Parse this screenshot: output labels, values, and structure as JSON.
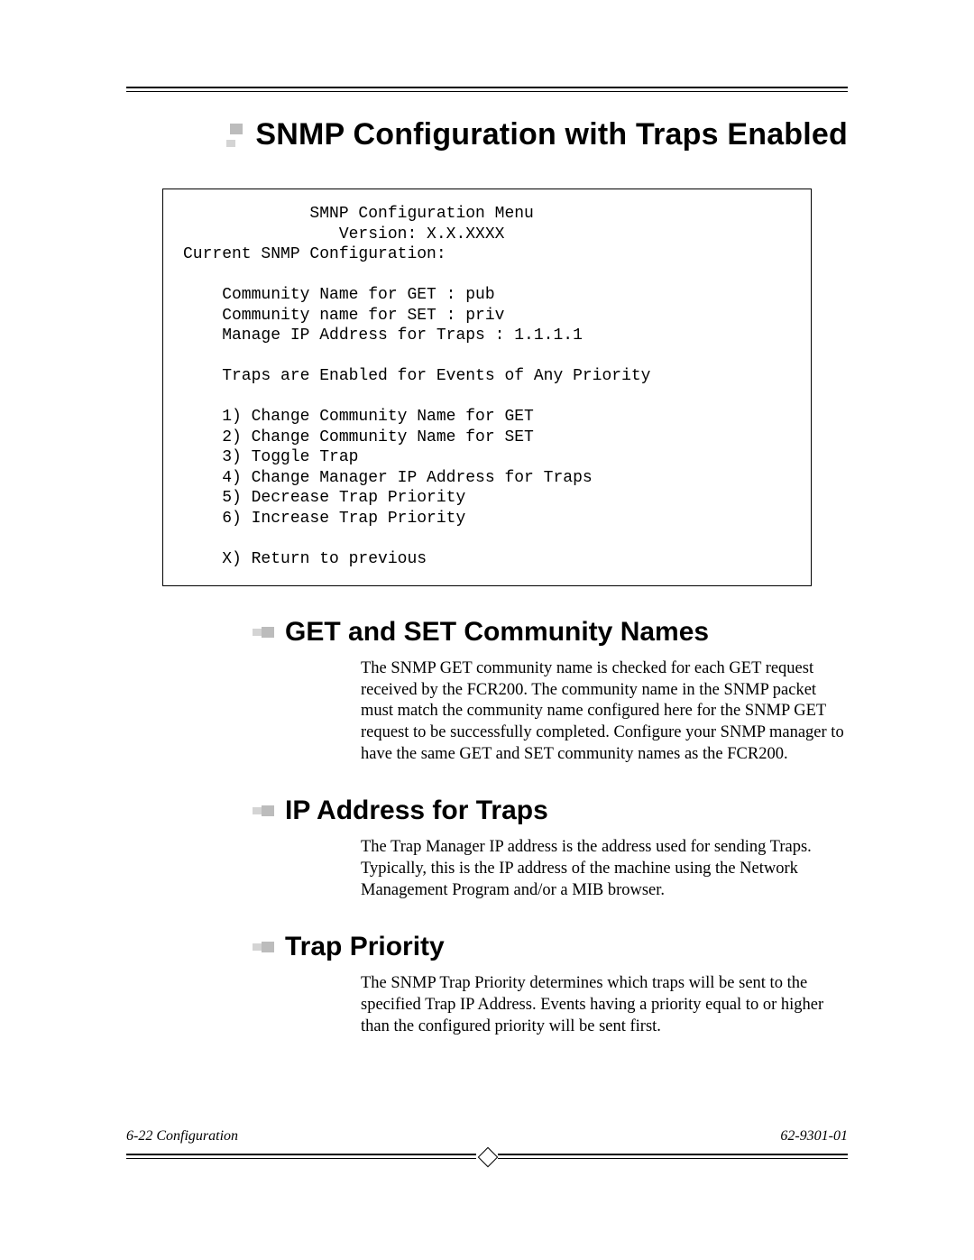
{
  "heading_main": "SNMP Configuration with Traps Enabled",
  "configbox": {
    "title": "             SMNP Configuration Menu",
    "version": "                Version: X.X.XXXX",
    "current": "Current SNMP Configuration:",
    "get": "    Community Name for GET : pub",
    "set": "    Community name for SET : priv",
    "ip": "    Manage IP Address for Traps : 1.1.1.1",
    "enabled": "    Traps are Enabled for Events of Any Priority",
    "opt1": "    1) Change Community Name for GET",
    "opt2": "    2) Change Community Name for SET",
    "opt3": "    3) Toggle Trap",
    "opt4": "    4) Change Manager IP Address for Traps",
    "opt5": "    5) Decrease Trap Priority",
    "opt6": "    6) Increase Trap Priority",
    "optX": "    X) Return to previous"
  },
  "sec1": {
    "title": "GET and SET Community Names",
    "body": "The SNMP GET community name is checked for each GET request received by the FCR200. The community name in the SNMP packet must match the community name configured here for the SNMP GET request to be successfully completed. Configure your SNMP manager to have the same GET and SET community names as the FCR200."
  },
  "sec2": {
    "title": "IP Address for Traps",
    "body": "The Trap Manager IP address is the address used for sending Traps. Typically, this is the IP address of the machine using the Network Management Program and/or a MIB browser."
  },
  "sec3": {
    "title": "Trap Priority",
    "body": "The SNMP Trap Priority determines which traps will be sent to the specified Trap IP Address. Events having a priority equal to or higher than the configured priority will be sent first."
  },
  "footer": {
    "left": "6-22    Configuration",
    "right": "62-9301-01"
  }
}
